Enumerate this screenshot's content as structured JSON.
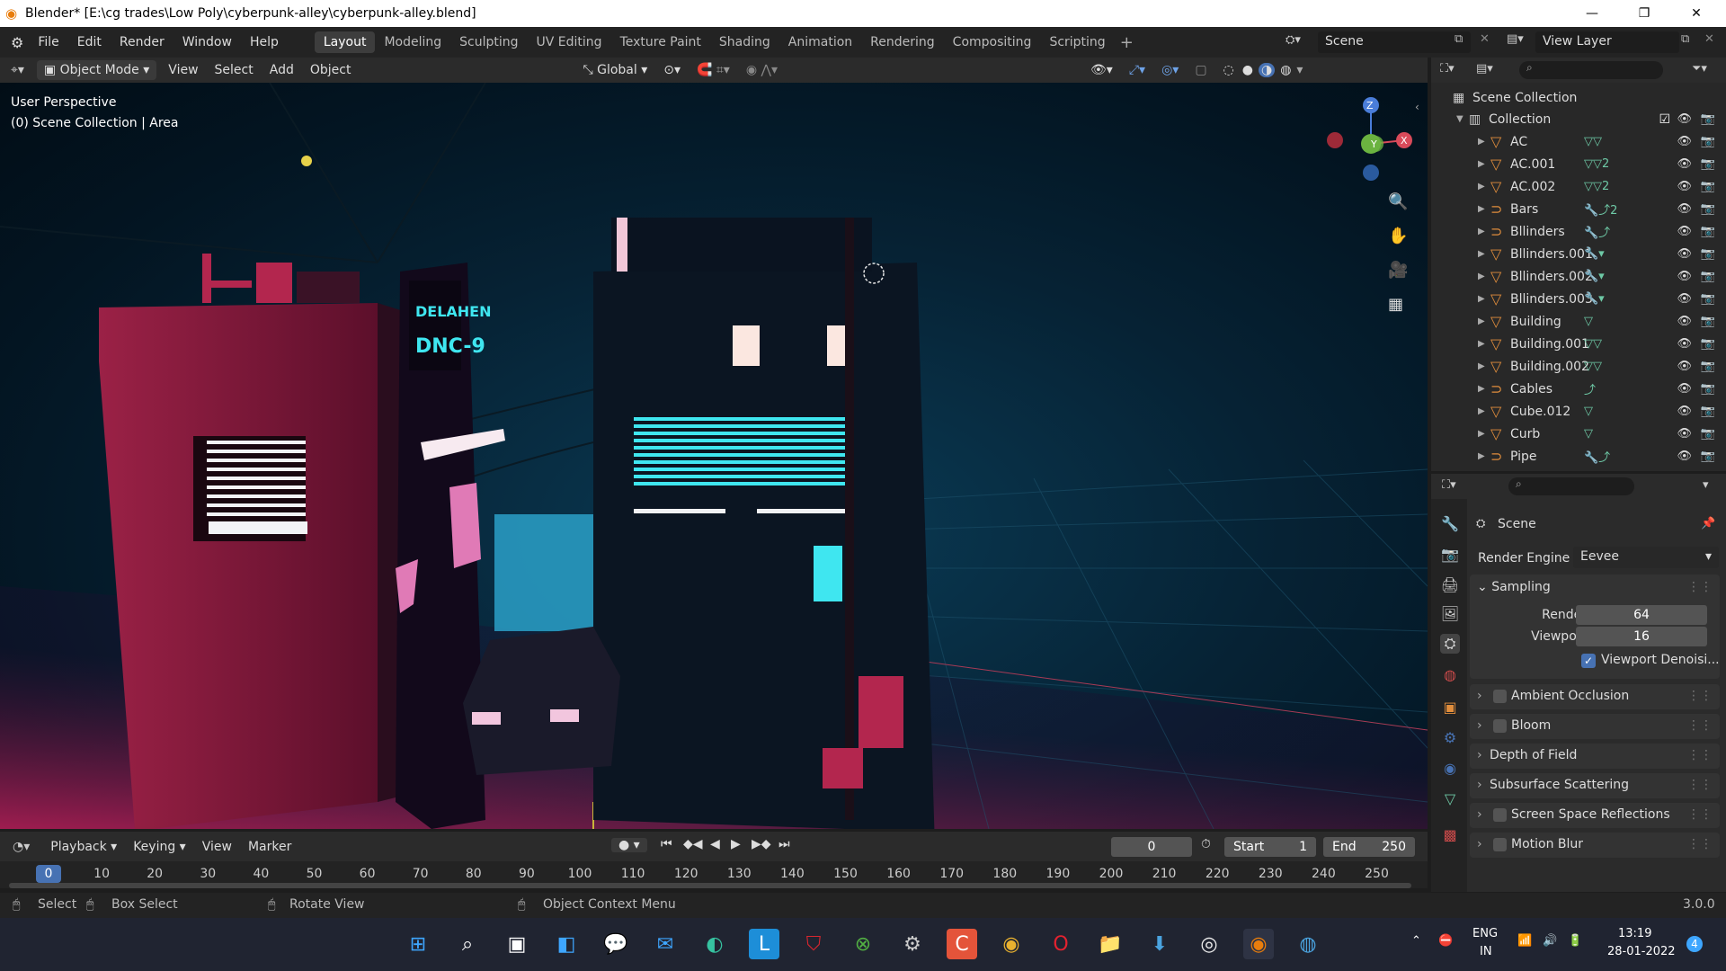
{
  "window": {
    "title": "Blender* [E:\\cg trades\\Low Poly\\cyberpunk-alley\\cyberpunk-alley.blend]",
    "controls": [
      "—",
      "❐",
      "✕"
    ]
  },
  "menus": [
    "File",
    "Edit",
    "Render",
    "Window",
    "Help"
  ],
  "workspaces": [
    "Layout",
    "Modeling",
    "Sculpting",
    "UV Editing",
    "Texture Paint",
    "Shading",
    "Animation",
    "Rendering",
    "Compositing",
    "Scripting"
  ],
  "active_workspace": "Layout",
  "scene_name": "Scene",
  "view_layer": "View Layer",
  "viewport_header": {
    "mode": "Object Mode",
    "menus": [
      "View",
      "Select",
      "Add",
      "Object"
    ],
    "transform_orientation": "Global"
  },
  "viewport": {
    "perspective": "User Perspective",
    "collection_info": "(0) Scene Collection | Area",
    "gizmo_axes": [
      "Z",
      "Y",
      "X"
    ],
    "sign_text": "DELAHEN",
    "sign_text2": "DNC-9"
  },
  "outliner": {
    "root": "Scene Collection",
    "collection": "Collection",
    "items": [
      {
        "name": "AC",
        "type": "mesh",
        "extra": "▽▽"
      },
      {
        "name": "AC.001",
        "type": "mesh",
        "extra": "▽▽2"
      },
      {
        "name": "AC.002",
        "type": "mesh",
        "extra": "▽▽2"
      },
      {
        "name": "Bars",
        "type": "curve",
        "extra": "🔧⤴2"
      },
      {
        "name": "Bllinders",
        "type": "curve",
        "extra": "🔧⤴"
      },
      {
        "name": "Bllinders.001",
        "type": "mesh",
        "extra": "🔧▾"
      },
      {
        "name": "Bllinders.002",
        "type": "mesh",
        "extra": "🔧▾"
      },
      {
        "name": "Bllinders.003",
        "type": "mesh",
        "extra": "🔧▾"
      },
      {
        "name": "Building",
        "type": "mesh",
        "extra": "▽"
      },
      {
        "name": "Building.001",
        "type": "mesh",
        "extra": "▽▽"
      },
      {
        "name": "Building.002",
        "type": "mesh",
        "extra": "▽▽"
      },
      {
        "name": "Cables",
        "type": "curve",
        "extra": "⤴"
      },
      {
        "name": "Cube.012",
        "type": "mesh",
        "extra": "▽"
      },
      {
        "name": "Curb",
        "type": "mesh",
        "extra": "▽"
      },
      {
        "name": "Pipe",
        "type": "curve",
        "extra": "🔧⤴"
      }
    ]
  },
  "properties": {
    "context": "Scene",
    "render_engine_label": "Render Engine",
    "render_engine": "Eevee",
    "sampling": {
      "title": "Sampling",
      "render_label": "Render",
      "render_value": "64",
      "viewport_label": "Viewport",
      "viewport_value": "16",
      "denoise_label": "Viewport Denoisi..."
    },
    "panels": [
      {
        "label": "Ambient Occlusion",
        "checkbox": true
      },
      {
        "label": "Bloom",
        "checkbox": true
      },
      {
        "label": "Depth of Field",
        "checkbox": false
      },
      {
        "label": "Subsurface Scattering",
        "checkbox": false
      },
      {
        "label": "Screen Space Reflections",
        "checkbox": true
      },
      {
        "label": "Motion Blur",
        "checkbox": true
      }
    ]
  },
  "timeline": {
    "menus": [
      "Playback",
      "Keying",
      "View",
      "Marker"
    ],
    "current_frame": "0",
    "start_label": "Start",
    "start": "1",
    "end_label": "End",
    "end": "250",
    "ruler": [
      "0",
      "10",
      "20",
      "30",
      "40",
      "50",
      "60",
      "70",
      "80",
      "90",
      "100",
      "110",
      "120",
      "130",
      "140",
      "150",
      "160",
      "170",
      "180",
      "190",
      "200",
      "210",
      "220",
      "230",
      "240",
      "250"
    ]
  },
  "status": {
    "select": "Select",
    "box_select": "Box Select",
    "rotate_view": "Rotate View",
    "context_menu": "Object Context Menu",
    "version": "3.0.0"
  },
  "taskbar": {
    "lang": "ENG",
    "region": "IN",
    "time": "13:19",
    "date": "28-01-2022",
    "notif": "4"
  },
  "colors": {
    "accent_blue": "#4772b3",
    "mesh_orange": "#e08d3c",
    "neon_cyan": "#3fe6f0",
    "neon_pink": "#e23d7a"
  }
}
